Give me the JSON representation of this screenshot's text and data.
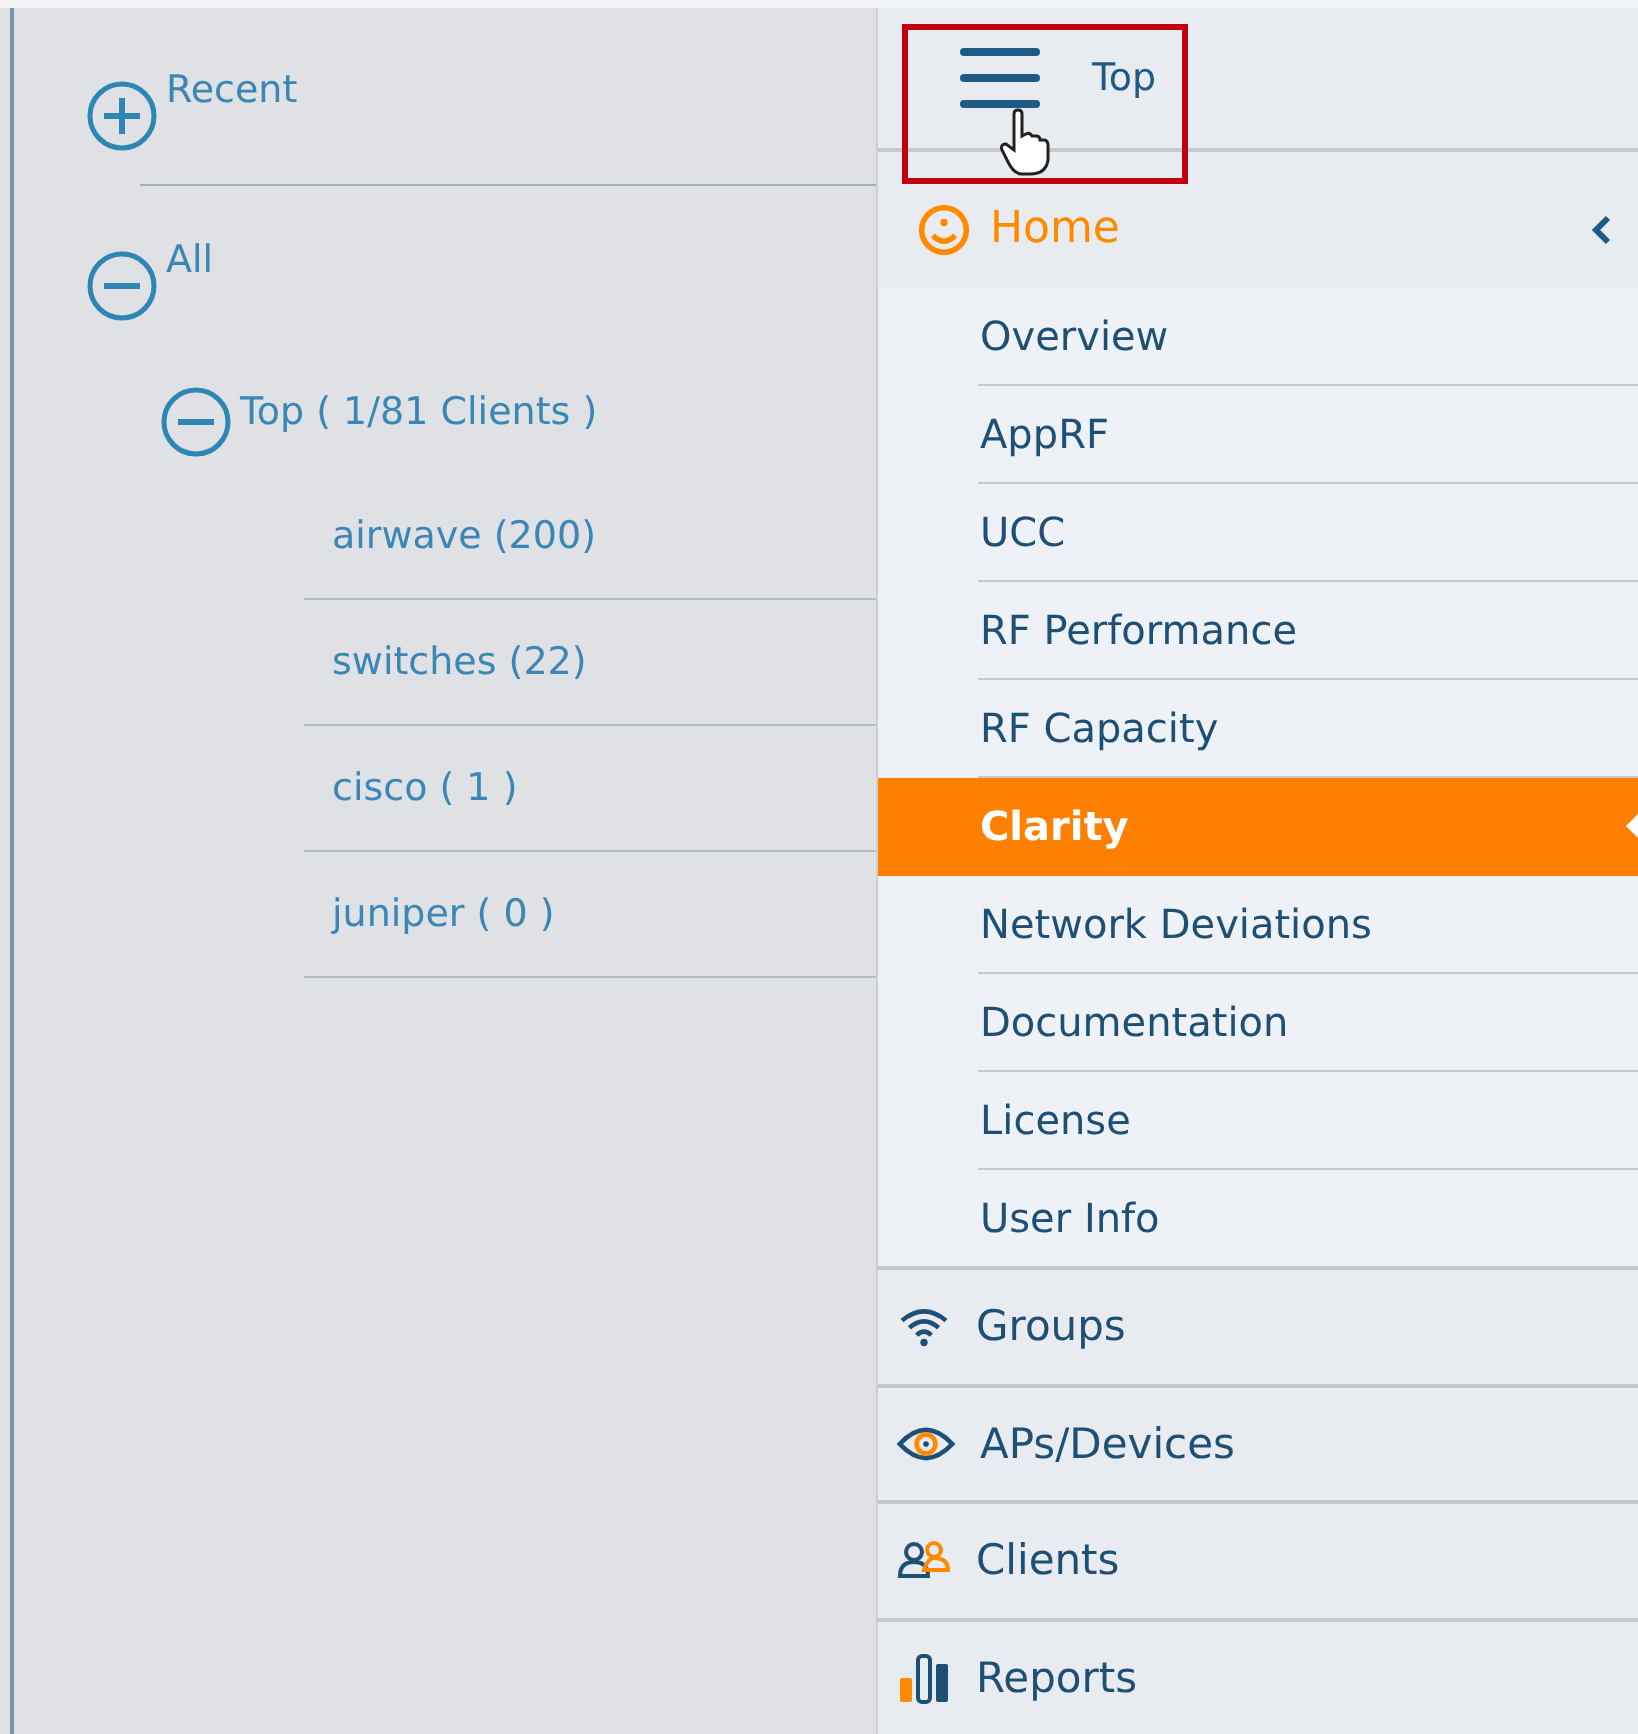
{
  "tree": [
    {
      "label": "Recent",
      "expanded": false
    },
    {
      "label": "All",
      "expanded": true,
      "children": [
        {
          "label": "Top ( 1/81 Clients )",
          "expanded": true,
          "children": [
            {
              "label": "airwave (200)"
            },
            {
              "label": "switches (22)"
            },
            {
              "label": "cisco ( 1 )"
            },
            {
              "label": "juniper ( 0 )"
            }
          ]
        }
      ]
    }
  ],
  "menu": {
    "title": "Top",
    "home": {
      "label": "Home",
      "expanded": true,
      "items": [
        {
          "label": "Overview",
          "selected": false
        },
        {
          "label": "AppRF",
          "selected": false
        },
        {
          "label": "UCC",
          "selected": false
        },
        {
          "label": "RF Performance",
          "selected": false
        },
        {
          "label": "RF Capacity",
          "selected": false
        },
        {
          "label": "Clarity",
          "selected": true
        },
        {
          "label": "Network Deviations",
          "selected": false
        },
        {
          "label": "Documentation",
          "selected": false
        },
        {
          "label": "License",
          "selected": false
        },
        {
          "label": "User Info",
          "selected": false
        }
      ]
    },
    "sections": [
      {
        "label": "Groups"
      },
      {
        "label": "APs/Devices"
      },
      {
        "label": "Clients"
      },
      {
        "label": "Reports"
      }
    ]
  }
}
